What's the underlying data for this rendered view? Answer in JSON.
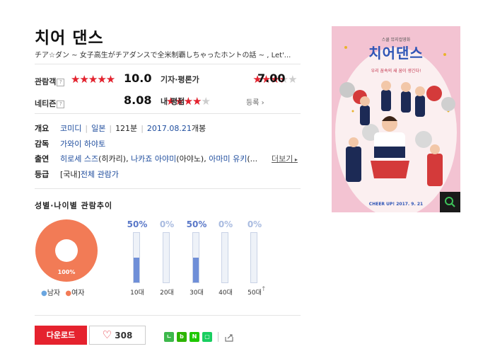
{
  "movie": {
    "title": "치어 댄스",
    "original_title": "チア☆ダン ~ 女子高生がチアダンスで全米制覇しちゃったホントの話 ~ , Let'..."
  },
  "ratings": {
    "audience": {
      "label": "관람객",
      "score": "10.0",
      "fraction": 1.0
    },
    "critic": {
      "label": "기자·평론가",
      "score": "7.00",
      "fraction": 0.7
    },
    "netizen": {
      "label": "네티즌",
      "score": "8.08",
      "fraction": 0.808
    },
    "my": {
      "label": "내 평점",
      "register": "등록",
      "fraction": 0
    }
  },
  "info": {
    "overview_label": "개요",
    "genre": "코미디",
    "country": "일본",
    "runtime": "121분",
    "release_date": "2017.08.21",
    "release_suffix": "개봉",
    "director_label": "감독",
    "director": "가와이 하야토",
    "cast_label": "출연",
    "cast": [
      {
        "name": "히로세 스즈",
        "role": "(히카리)"
      },
      {
        "name": "나카죠 아야미",
        "role": "(아야노)"
      },
      {
        "name": "아마미 유키",
        "role": "(..."
      }
    ],
    "more": "더보기",
    "rating_label": "등급",
    "rating_prefix": "[국내]",
    "rating_value": "전체 관람가"
  },
  "trend": {
    "title": "성별·나이별 관람추이",
    "pie_percent": "100%",
    "legend_male": "남자",
    "legend_female": "여자",
    "female_share": 1.0,
    "colors": {
      "female": "#f27b56",
      "male": "#6aa6e0",
      "bar": "#6f8fd8"
    },
    "ages": [
      {
        "label": "10대",
        "pct": "50%",
        "value": 50
      },
      {
        "label": "20대",
        "pct": "0%",
        "value": 0
      },
      {
        "label": "30대",
        "pct": "50%",
        "value": 50
      },
      {
        "label": "40대",
        "pct": "0%",
        "value": 0
      },
      {
        "label": "50대",
        "pct": "0%",
        "value": 0
      }
    ]
  },
  "actions": {
    "download": "다운로드",
    "like_count": "308"
  },
  "poster": {
    "title": "치어댄스",
    "tagline": "우리 꿈속의 새 꿈이 생긴다!",
    "bottom": "CHEER UP! 2017. 9. 21",
    "top_line": "스쿨 뮤지컬영화"
  }
}
